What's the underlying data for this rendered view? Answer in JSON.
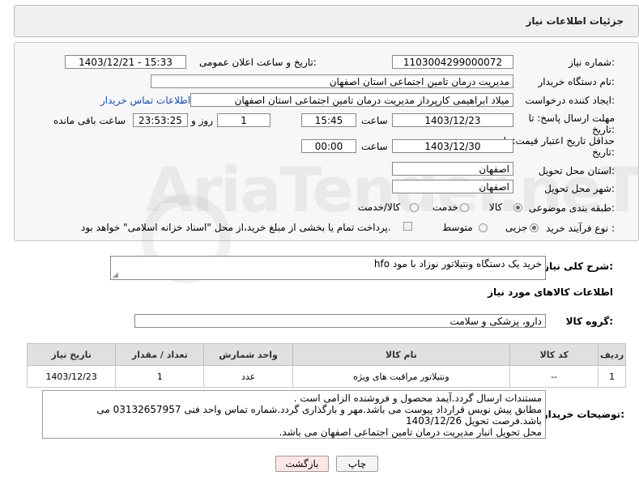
{
  "header": {
    "title": "جزئیات اطلاعات نیاز"
  },
  "form": {
    "need_number_label": "شماره نیاز:",
    "need_number": "1103004299000072",
    "announce_label": "تاریخ و ساعت اعلان عمومی:",
    "announce_value": "1403/12/21 - 15:33",
    "buyer_label": "نام دستگاه خریدار:",
    "buyer_value": "مدیریت درمان تامین اجتماعی استان اصفهان",
    "creator_label": "ایجاد کننده درخواست:",
    "creator_value": "میلاد ابراهیمی کارپرداز مدیریت درمان تامین اجتماعی استان اصفهان",
    "contact_link": "اطلاعات تماس خریدار",
    "deadline_label_1": "مهلت ارسال پاسخ: تا",
    "deadline_label_2": "تاریخ:",
    "deadline_date": "1403/12/23",
    "time_label": "ساعت",
    "deadline_time": "15:45",
    "days_value": "1",
    "days_label": "روز و",
    "remaining_value": "23:53:25",
    "remaining_label": "ساعت باقی مانده",
    "validity_label_1": "حداقل تاریخ اعتبار قیمت: تا",
    "validity_label_2": "تاریخ:",
    "validity_date": "1403/12/30",
    "validity_time_label": "ساعت",
    "validity_time": "00:00",
    "province_label": "استان محل تحویل:",
    "province_value": "اصفهان",
    "city_label": "شهر محل تحویل:",
    "city_value": "اصفهان",
    "category_label": "طبقه بندی موضوعی:",
    "category_options": [
      "کالا",
      "خدمت",
      "کالا/خدمت"
    ],
    "category_selected": "کالا",
    "process_label": "نوع فرآیند خرید :",
    "process_options": [
      "جزیی",
      "متوسط"
    ],
    "process_selected": "جزیی",
    "payment_text": "پرداخت تمام یا بخشی از مبلغ خرید،از محل \"اسناد خزانه اسلامی\" خواهد بود."
  },
  "summary": {
    "label": "شرح کلی نیاز:",
    "value": "خرید یک دستگاه ونتیلاتور نوزاد با مود hfo"
  },
  "goods": {
    "section_title": "اطلاعات کالاهای مورد نیاز",
    "group_label": "گروه کالا:",
    "group_value": "دارو، پزشکی و سلامت",
    "table": {
      "headers": [
        "ردیف",
        "کد کالا",
        "نام کالا",
        "واحد شمارش",
        "تعداد / مقدار",
        "تاریخ نیاز"
      ],
      "rows": [
        [
          "1",
          "--",
          "ونتیلاتور مراقبت های ویژه",
          "عدد",
          "1",
          "1403/12/23"
        ]
      ]
    }
  },
  "notes": {
    "label": "توضیحات خریدار:",
    "lines": [
      "مستندات ارسال گردد.آیمد محصول و فروشنده الزامی است .",
      "مطابق پیش نویس قرارداد پیوست می باشد.مهر و بارگذاری گردد.شماره تماس واحد فنی 03132657957 می باشد.فرصت تحویل 1403/12/26",
      "محل تحویل انبار مدیریت درمان تامین اجتماعی اصفهان می باشد."
    ]
  },
  "buttons": {
    "print": "چاپ",
    "back": "بازگشت"
  },
  "watermark": {
    "text": "AriaTender.neT"
  },
  "colors": {
    "link": "#1a4fb0",
    "back_button_bg": "#fde6e6",
    "header_bg": "#e0e0e0"
  }
}
